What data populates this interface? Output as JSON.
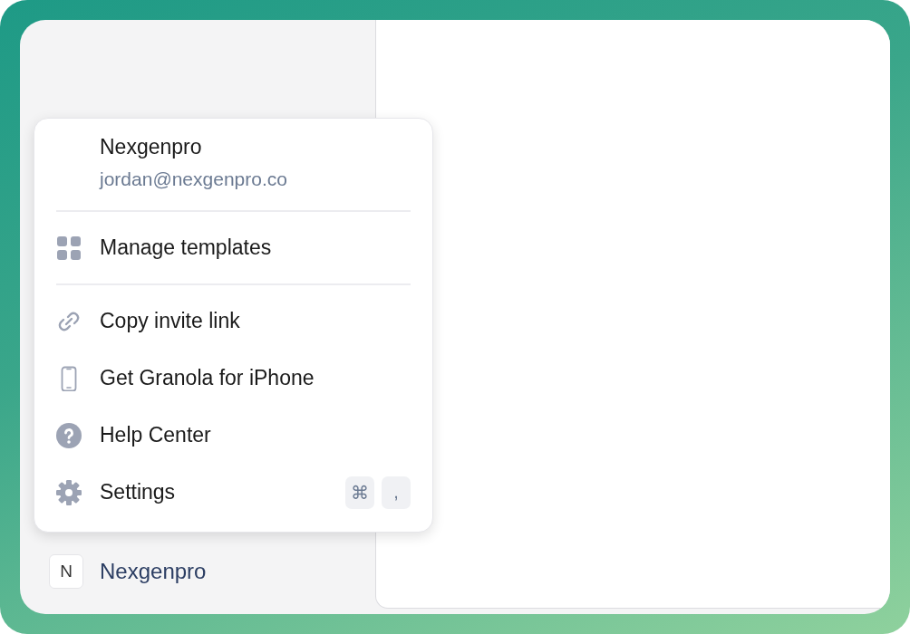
{
  "account_menu": {
    "name": "Nexgenpro",
    "email": "jordan@nexgenpro.co",
    "sections": [
      [
        {
          "label": "Manage templates"
        }
      ],
      [
        {
          "label": "Copy invite link"
        },
        {
          "label": "Get Granola for iPhone"
        },
        {
          "label": "Help Center"
        },
        {
          "label": "Settings",
          "shortcut": [
            "⌘",
            ","
          ]
        }
      ]
    ]
  },
  "workspace": {
    "initial": "N",
    "name": "Nexgenpro"
  }
}
